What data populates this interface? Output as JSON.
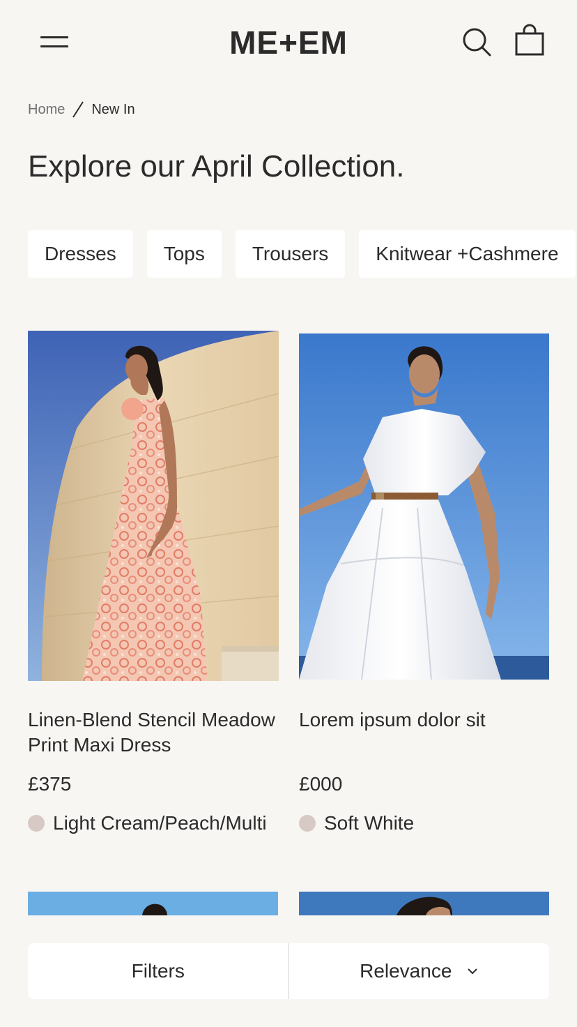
{
  "header": {
    "logo": "ME+EM",
    "menu_icon": "hamburger-menu-icon",
    "search_icon": "search-icon",
    "bag_icon": "shopping-bag-icon"
  },
  "breadcrumb": {
    "home": "Home",
    "current": "New In"
  },
  "page_title": "Explore our April Collection.",
  "categories": [
    "Dresses",
    "Tops",
    "Trousers",
    "Knitwear +Cashmere"
  ],
  "products": [
    {
      "name": "Linen-Blend Stencil Meadow Print Maxi Dress",
      "price": "£375",
      "colour": "Light Cream/Peach/Multi",
      "swatch_color": "#d7c9c3"
    },
    {
      "name": "Lorem ipsum dolor sit",
      "price": "£000",
      "colour": "Soft White",
      "swatch_color": "#d7c9c3"
    }
  ],
  "bottom_bar": {
    "filters_label": "Filters",
    "sort_label": "Relevance",
    "sort_icon": "chevron-down-icon"
  },
  "colors": {
    "background": "#f7f6f3",
    "text": "#2b2b2b",
    "chip_bg": "#ffffff"
  }
}
